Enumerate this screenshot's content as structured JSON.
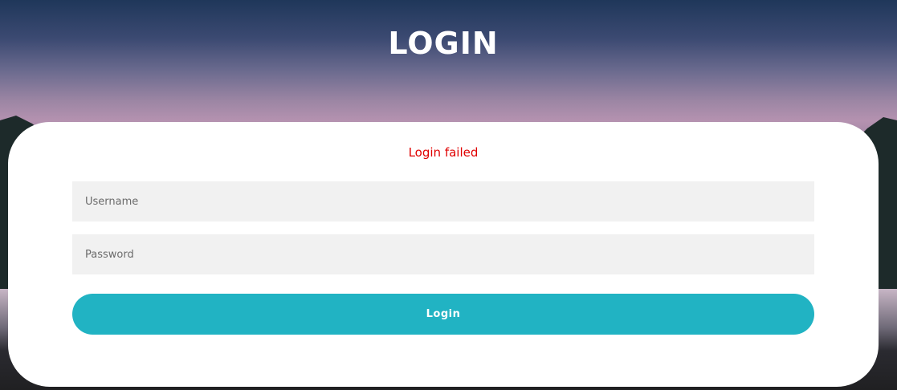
{
  "page": {
    "title": "LOGIN"
  },
  "form": {
    "error_message": "Login failed",
    "username_placeholder": "Username",
    "password_placeholder": "Password",
    "submit_label": "Login"
  },
  "colors": {
    "error": "#e00000",
    "button": "#21b3c3",
    "field_background": "#f1f1f1",
    "card_background": "#ffffff"
  }
}
